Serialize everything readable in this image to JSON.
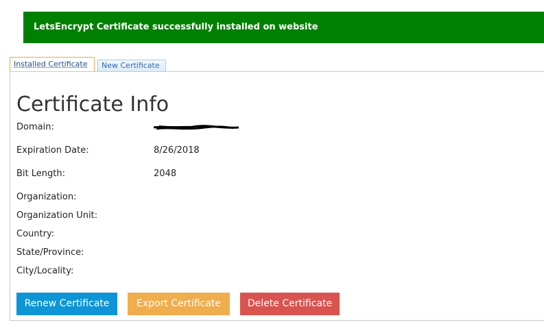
{
  "alert": {
    "message": "LetsEncrypt Certificate successfully installed on website",
    "color": "#008000"
  },
  "tabs": [
    {
      "label": "Installed Certificate",
      "active": true
    },
    {
      "label": "New Certificate",
      "active": false
    }
  ],
  "panel": {
    "title": "Certificate Info",
    "fields": [
      {
        "label": "Domain:",
        "value": ""
      },
      {
        "label": "Expiration Date:",
        "value": "8/26/2018"
      },
      {
        "label": "Bit Length:",
        "value": "2048"
      },
      {
        "label": "Organization:",
        "value": ""
      },
      {
        "label": "Organization Unit:",
        "value": ""
      },
      {
        "label": "Country:",
        "value": ""
      },
      {
        "label": "State/Province:",
        "value": ""
      },
      {
        "label": "City/Locality:",
        "value": ""
      }
    ]
  },
  "buttons": {
    "renew": {
      "label": "Renew Certificate",
      "color": "#0e95d6"
    },
    "export": {
      "label": "Export Certificate",
      "color": "#f0ad4e"
    },
    "delete": {
      "label": "Delete Certificate",
      "color": "#d9534f"
    }
  }
}
